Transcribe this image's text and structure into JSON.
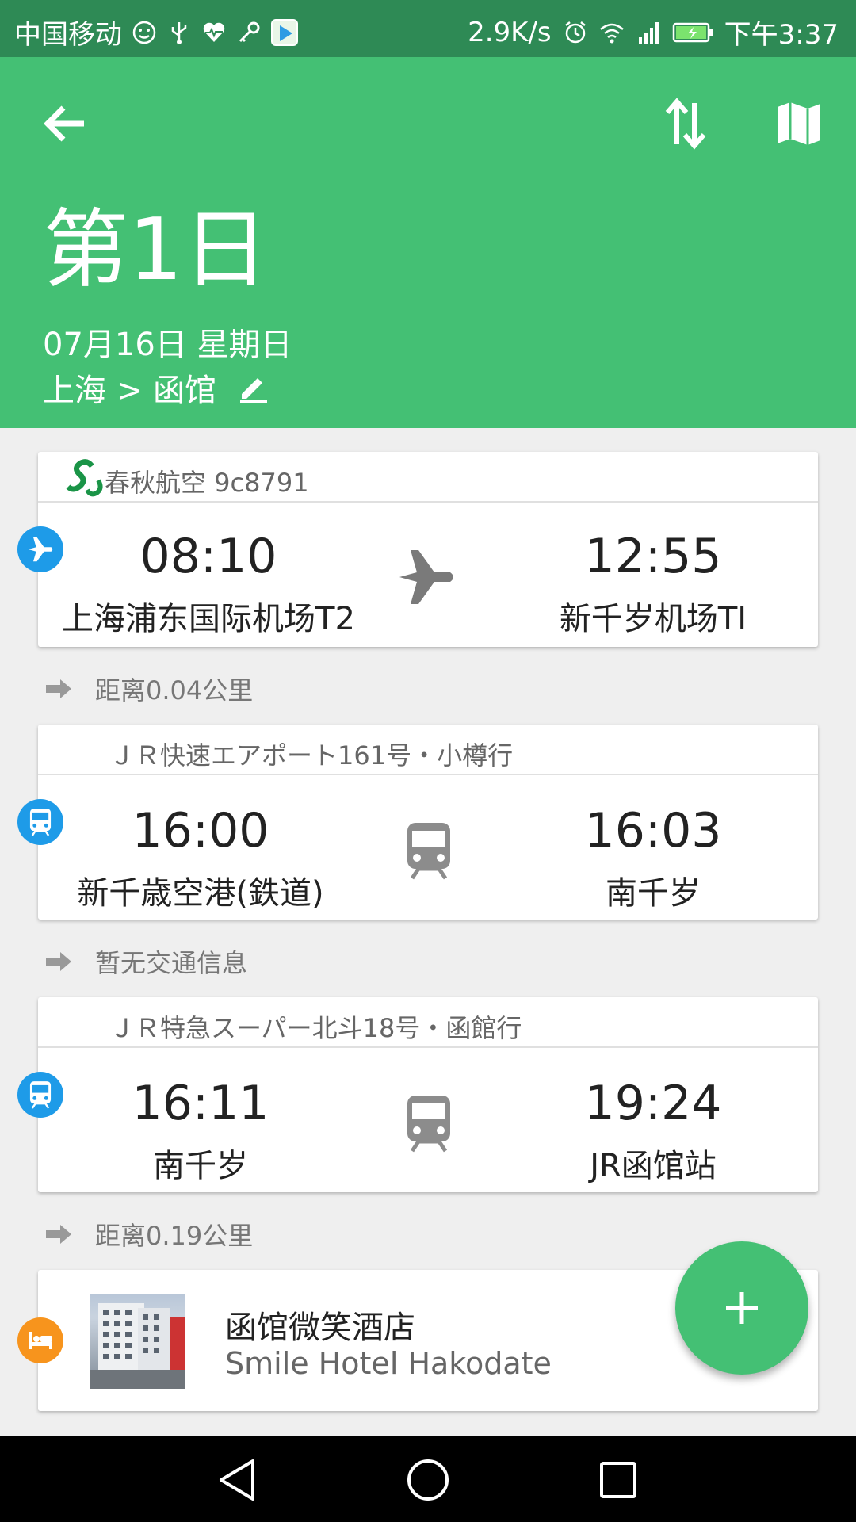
{
  "status_bar": {
    "carrier": "中国移动",
    "speed": "2.9K/s",
    "time": "下午3:37"
  },
  "header": {
    "title": "第1日",
    "date": "07月16日 星期日",
    "route": "上海 > 函馆"
  },
  "icons": {
    "back": "back-arrow-icon",
    "swap": "swap-vertical-icon",
    "map": "map-icon",
    "edit": "edit-icon",
    "plane": "plane-icon",
    "train": "train-icon",
    "hotel": "bed-icon",
    "add": "plus-icon"
  },
  "colors": {
    "primary": "#44c074",
    "status_bar": "#2e8a55",
    "badge_blue": "#1e9be8",
    "badge_orange": "#f7941d"
  },
  "items": [
    {
      "kind": "flight",
      "title": "春秋航空 9c8791",
      "depart_time": "08:10",
      "depart_place": "上海浦东国际机场T2",
      "arrive_time": "12:55",
      "arrive_place": "新千岁机场TI"
    },
    {
      "kind": "separator",
      "text": "距离0.04公里"
    },
    {
      "kind": "train",
      "title": "ＪＲ快速エアポート161号・小樽行",
      "depart_time": "16:00",
      "depart_place": "新千歳空港(鉄道)",
      "arrive_time": "16:03",
      "arrive_place": "南千岁"
    },
    {
      "kind": "separator",
      "text": "暂无交通信息"
    },
    {
      "kind": "train",
      "title": "ＪＲ特急スーパー北斗18号・函館行",
      "depart_time": "16:11",
      "depart_place": "南千岁",
      "arrive_time": "19:24",
      "arrive_place": "JR函馆站"
    },
    {
      "kind": "separator",
      "text": "距离0.19公里"
    },
    {
      "kind": "hotel",
      "name_cn": "函馆微笑酒店",
      "name_en": "Smile Hotel Hakodate"
    }
  ]
}
